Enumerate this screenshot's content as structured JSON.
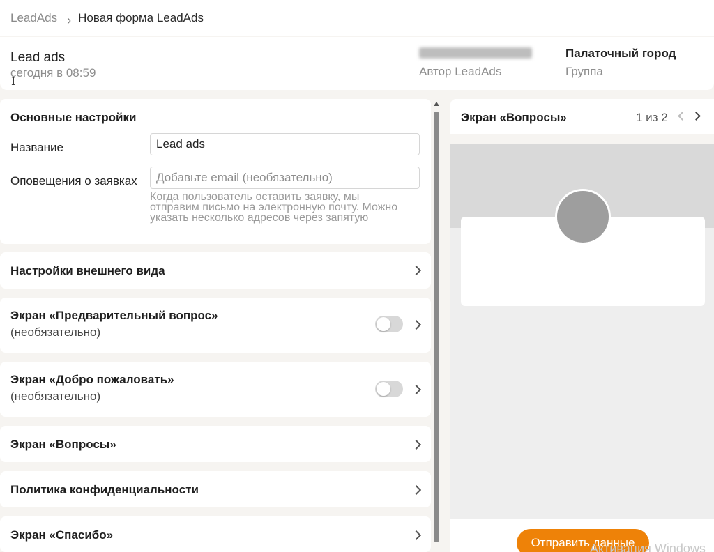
{
  "breadcrumb": {
    "root": "LeadAds",
    "separator": "›",
    "current": "Новая форма LeadAds"
  },
  "header": {
    "title": "Lead ads",
    "timestamp": "сегодня в 08:59",
    "author_role": "Автор LeadAds",
    "group_name": "Палаточный город",
    "group_role": "Группа"
  },
  "settings": {
    "title": "Основные настройки",
    "name_label": "Название",
    "name_value": "Lead ads",
    "notify_label": "Оповещения о заявках",
    "notify_placeholder": "Добавьте email (необязательно)",
    "notify_hint": "Когда пользователь оставить заявку, мы отправим письмо на электронную почту. Можно указать несколько адресов через запятую"
  },
  "sections": {
    "appearance": "Настройки внешнего вида",
    "pre_question": {
      "title": "Экран «Предварительный вопрос»",
      "subtitle": "(необязательно)",
      "enabled": false
    },
    "welcome": {
      "title": "Экран «Добро пожаловать»",
      "subtitle": "(необязательно)",
      "enabled": false
    },
    "questions": "Экран «Вопросы»",
    "privacy": "Политика конфиденциальности",
    "thanks": "Экран «Спасибо»"
  },
  "preview": {
    "title": "Экран «Вопросы»",
    "page_counter": "1 из 2",
    "submit_label": "Отправить данные",
    "watermark": "Активация Windows"
  },
  "colors": {
    "accent": "#ee8208",
    "page_bg": "#f6f4f1",
    "preview_bg": "#eeeeee",
    "preview_cover": "#d9d9d9",
    "avatar": "#9e9e9e"
  }
}
